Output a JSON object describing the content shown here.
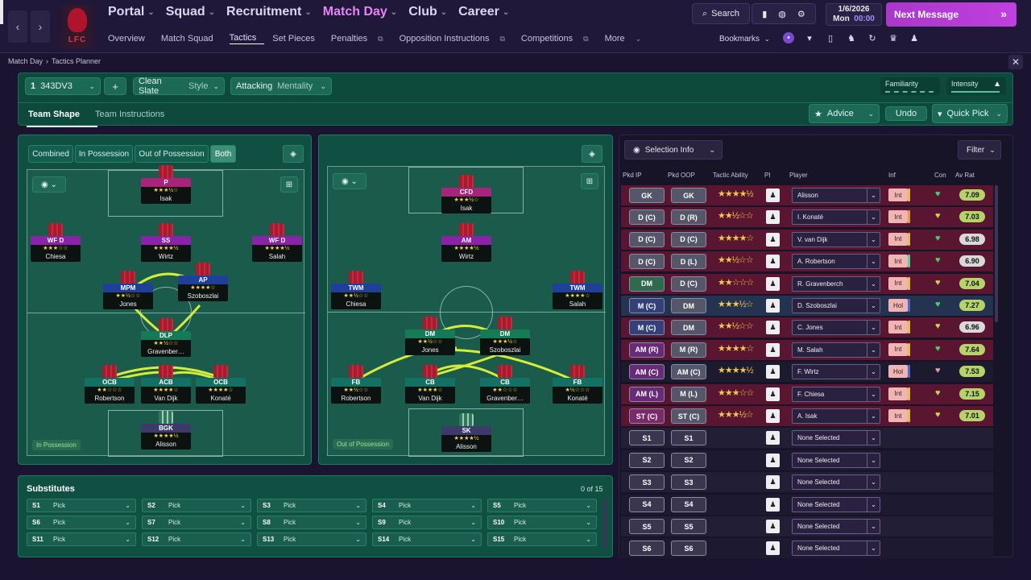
{
  "nav": {
    "main": [
      {
        "label": "Portal"
      },
      {
        "label": "Squad"
      },
      {
        "label": "Recruitment"
      },
      {
        "label": "Match Day"
      },
      {
        "label": "Club"
      },
      {
        "label": "Career"
      }
    ],
    "sub": [
      {
        "label": "Overview"
      },
      {
        "label": "Match Squad"
      },
      {
        "label": "Tactics"
      },
      {
        "label": "Set Pieces"
      },
      {
        "label": "Penalties"
      },
      {
        "label": "Opposition Instructions"
      },
      {
        "label": "Competitions"
      },
      {
        "label": "More"
      }
    ],
    "club_logo": "LFC"
  },
  "topbar": {
    "search": "Search",
    "date": "1/6/2026",
    "day": "Mon",
    "time": "00:00",
    "next": "Next Message",
    "bookmarks": "Bookmarks"
  },
  "breadcrumb": [
    "Match Day",
    "Tactics Planner"
  ],
  "tactic": {
    "slot": "1",
    "formation": "343DV3",
    "style_value": "Clean Slate",
    "style_label": "Style",
    "mentality_value": "Attacking",
    "mentality_label": "Mentality",
    "familiarity": "Familiarity",
    "intensity": "Intensity"
  },
  "tabs": {
    "shape": "Team Shape",
    "instructions": "Team Instructions",
    "advice": "Advice",
    "undo": "Undo",
    "quickpick": "Quick Pick"
  },
  "views": {
    "combined": "Combined",
    "in": "In Possession",
    "out": "Out of Possession",
    "both": "Both"
  },
  "pitch_in": {
    "label": "In Possession",
    "players": [
      {
        "role": "P",
        "name": "Isak",
        "stars": "★★★½☆",
        "color": "#a8237a"
      },
      {
        "role": "WF D",
        "name": "Chiesa",
        "stars": "★★★☆☆",
        "color": "#8a23a8"
      },
      {
        "role": "SS",
        "name": "Wirtz",
        "stars": "★★★★½",
        "color": "#8a23a8"
      },
      {
        "role": "WF D",
        "name": "Salah",
        "stars": "★★★★½",
        "color": "#8a23a8"
      },
      {
        "role": "MPM",
        "name": "Jones",
        "stars": "★★½☆☆",
        "color": "#1e3f9a"
      },
      {
        "role": "AP",
        "name": "Szoboszlai",
        "stars": "★★★★☆",
        "color": "#1e3f9a"
      },
      {
        "role": "DLP",
        "name": "Gravenber…",
        "stars": "★★½☆☆",
        "color": "#157b56"
      },
      {
        "role": "OCB",
        "name": "Robertson",
        "stars": "★★☆☆☆",
        "color": "#137163"
      },
      {
        "role": "ACB",
        "name": "Van Dijk",
        "stars": "★★★★☆",
        "color": "#137163"
      },
      {
        "role": "OCB",
        "name": "Konaté",
        "stars": "★★★★☆",
        "color": "#137163"
      },
      {
        "role": "BGK",
        "name": "Alisson",
        "stars": "★★★★½",
        "color": "#3d3a6a"
      }
    ]
  },
  "pitch_out": {
    "label": "Out of Possession",
    "players": [
      {
        "role": "CFD",
        "name": "Isak",
        "stars": "★★★½☆",
        "color": "#a8237a"
      },
      {
        "role": "AM",
        "name": "Wirtz",
        "stars": "★★★★½",
        "color": "#8a23a8"
      },
      {
        "role": "TWM",
        "name": "Chiesa",
        "stars": "★★½☆☆",
        "color": "#1e3f9a"
      },
      {
        "role": "TWM",
        "name": "Salah",
        "stars": "★★★★☆",
        "color": "#1e3f9a"
      },
      {
        "role": "DM",
        "name": "Jones",
        "stars": "★★½☆☆",
        "color": "#157b56"
      },
      {
        "role": "DM",
        "name": "Szoboszlai",
        "stars": "★★★½☆",
        "color": "#157b56"
      },
      {
        "role": "FB",
        "name": "Robertson",
        "stars": "★★½☆☆",
        "color": "#137163"
      },
      {
        "role": "CB",
        "name": "Van Dijk",
        "stars": "★★★★☆",
        "color": "#137163"
      },
      {
        "role": "CB",
        "name": "Gravenber…",
        "stars": "★★☆☆☆",
        "color": "#137163"
      },
      {
        "role": "FB",
        "name": "Konaté",
        "stars": "★½☆☆☆",
        "color": "#137163"
      },
      {
        "role": "SK",
        "name": "Alisson",
        "stars": "★★★★½",
        "color": "#3d3a6a"
      }
    ]
  },
  "subs": {
    "title": "Substitutes",
    "count": "0 of 15",
    "slots": [
      "S1",
      "S2",
      "S3",
      "S4",
      "S5",
      "S6",
      "S7",
      "S8",
      "S9",
      "S10",
      "S11",
      "S12",
      "S13",
      "S14",
      "S15"
    ],
    "pick": "Pick"
  },
  "selection": {
    "title": "Selection Info",
    "filter": "Filter",
    "headers": [
      "Pkd IP",
      "Pkd OOP",
      "Tactic Ability",
      "PI",
      "Player",
      "Inf",
      "Con",
      "Av Rat"
    ],
    "rows": [
      {
        "ip": "GK",
        "oop": "GK",
        "stars": "★★★★½",
        "player": "Alisson",
        "inf": "Int",
        "infc": "#e0c24a",
        "rat": "7.09",
        "ratc": "#b6d36a",
        "bg": "#5a1630",
        "ipc": "#55566a",
        "conc": "#4ad06a"
      },
      {
        "ip": "D (C)",
        "oop": "D (R)",
        "stars": "★★½☆☆",
        "player": "I. Konaté",
        "inf": "Int",
        "infc": "#e0a040",
        "rat": "7.03",
        "ratc": "#b6d36a",
        "bg": "#5a1630",
        "ipc": "#55566a",
        "conc": "#c8d84a"
      },
      {
        "ip": "D (C)",
        "oop": "D (C)",
        "stars": "★★★★☆",
        "player": "V. van Dijk",
        "inf": "Int",
        "infc": "#e0c24a",
        "rat": "6.98",
        "ratc": "#d9d9d9",
        "bg": "#5a1630",
        "ipc": "#55566a",
        "conc": "#4ad06a"
      },
      {
        "ip": "D (C)",
        "oop": "D (L)",
        "stars": "★★½☆☆",
        "player": "A. Robertson",
        "inf": "Int",
        "infc": "#5ad0a0",
        "rat": "6.90",
        "ratc": "#d9d9d9",
        "bg": "#5a1630",
        "ipc": "#55566a",
        "conc": "#4ad06a"
      },
      {
        "ip": "DM",
        "oop": "D (C)",
        "stars": "★★☆☆☆",
        "player": "R. Gravenberch",
        "inf": "Int",
        "infc": "#e0c24a",
        "rat": "7.04",
        "ratc": "#b6d36a",
        "bg": "#5a1630",
        "ipc": "#2e6a4e",
        "conc": "#c8d84a"
      },
      {
        "ip": "M (C)",
        "oop": "DM",
        "stars": "★★★½☆",
        "player": "D. Szoboszlai",
        "inf": "Hol",
        "infc": "#4a6ad0",
        "rat": "7.27",
        "ratc": "#b6d36a",
        "bg": "#233350",
        "ipc": "#33407a",
        "conc": "#4ad06a"
      },
      {
        "ip": "M (C)",
        "oop": "DM",
        "stars": "★★½☆☆",
        "player": "C. Jones",
        "inf": "Int",
        "infc": "#e0c24a",
        "rat": "6.96",
        "ratc": "#d9d9d9",
        "bg": "#5a1630",
        "ipc": "#33407a",
        "conc": "#c8d84a"
      },
      {
        "ip": "AM (R)",
        "oop": "M (R)",
        "stars": "★★★★☆",
        "player": "M. Salah",
        "inf": "Int",
        "infc": "#e0c24a",
        "rat": "7.64",
        "ratc": "#b6d36a",
        "bg": "#5a1630",
        "ipc": "#6a2a7a",
        "conc": "#4ad06a"
      },
      {
        "ip": "AM (C)",
        "oop": "AM (C)",
        "stars": "★★★★½",
        "player": "F. Wirtz",
        "inf": "Hol",
        "infc": "#4a6ad0",
        "rat": "7.53",
        "ratc": "#b6d36a",
        "bg": "#1c1a2e",
        "ipc": "#6a2a7a",
        "conc": "#e0a0a0"
      },
      {
        "ip": "AM (L)",
        "oop": "M (L)",
        "stars": "★★★☆☆",
        "player": "F. Chiesa",
        "inf": "Int",
        "infc": "#e0c24a",
        "rat": "7.15",
        "ratc": "#b6d36a",
        "bg": "#5a1630",
        "ipc": "#6a2a7a",
        "conc": "#c8d84a"
      },
      {
        "ip": "ST (C)",
        "oop": "ST (C)",
        "stars": "★★★½☆",
        "player": "A. Isak",
        "inf": "Int",
        "infc": "#e0c24a",
        "rat": "7.01",
        "ratc": "#b6d36a",
        "bg": "#5a1630",
        "ipc": "#7a2a6a",
        "conc": "#c8d84a"
      }
    ],
    "subs": [
      "S1",
      "S2",
      "S3",
      "S4",
      "S5",
      "S6"
    ],
    "none": "None Selected"
  }
}
